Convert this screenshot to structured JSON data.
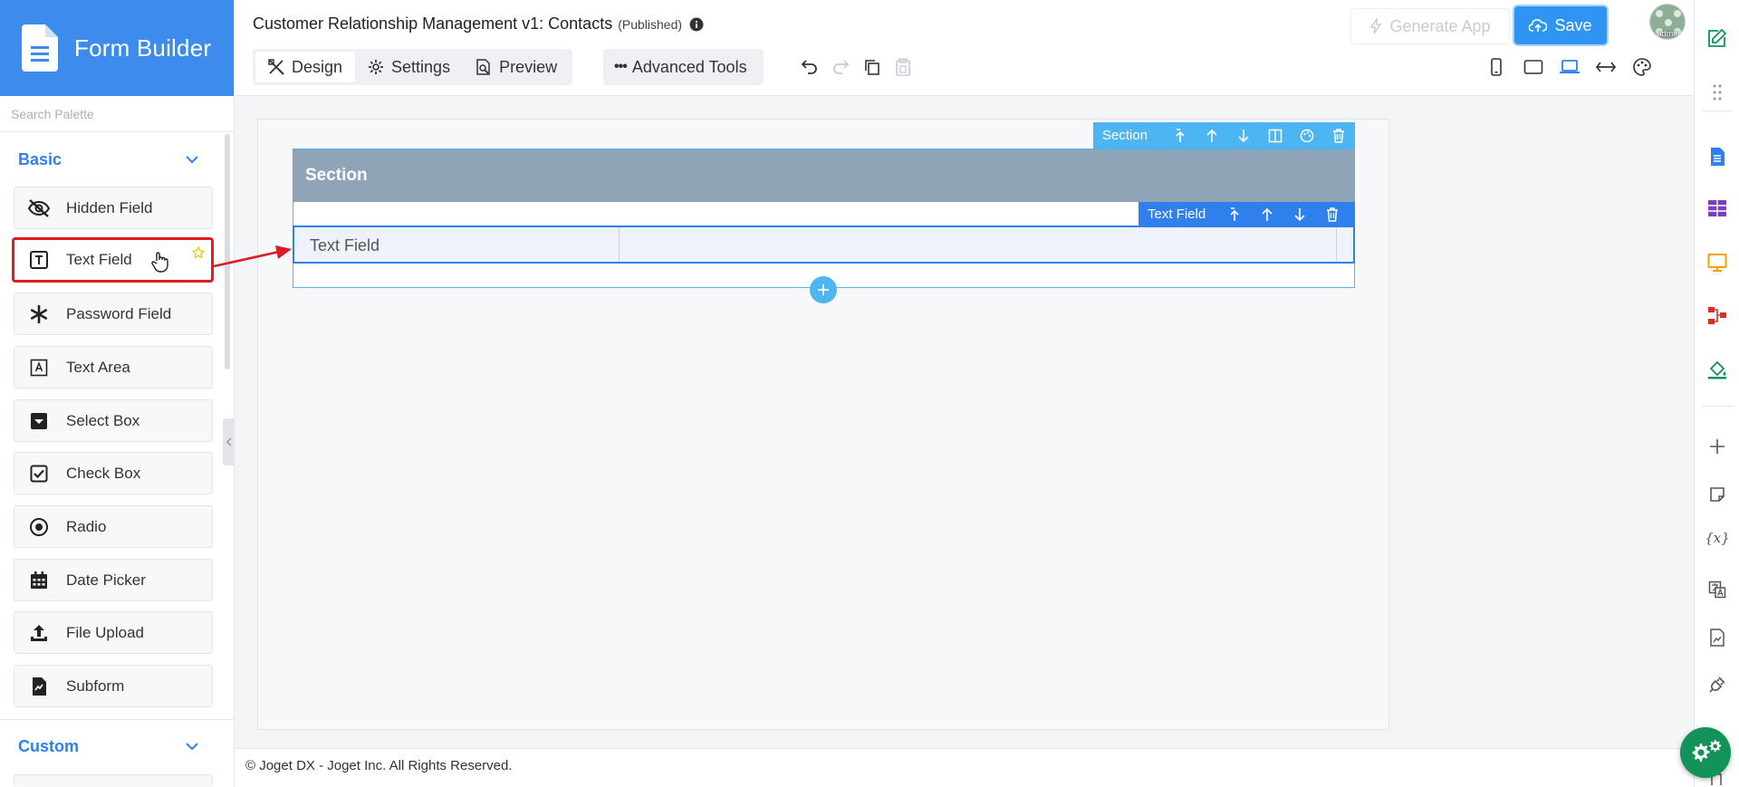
{
  "brand": {
    "title": "Form Builder"
  },
  "palette": {
    "search_placeholder": "Search Palette",
    "groups": [
      {
        "label": "Basic",
        "items": [
          {
            "label": "Hidden Field",
            "icon": "hidden-eye-icon"
          },
          {
            "label": "Text Field",
            "icon": "text-field-icon"
          },
          {
            "label": "Password Field",
            "icon": "asterisk-icon"
          },
          {
            "label": "Text Area",
            "icon": "text-area-icon"
          },
          {
            "label": "Select Box",
            "icon": "select-box-icon"
          },
          {
            "label": "Check Box",
            "icon": "checkbox-icon"
          },
          {
            "label": "Radio",
            "icon": "radio-icon"
          },
          {
            "label": "Date Picker",
            "icon": "calendar-icon"
          },
          {
            "label": "File Upload",
            "icon": "upload-icon"
          },
          {
            "label": "Subform",
            "icon": "subform-icon"
          }
        ]
      },
      {
        "label": "Custom",
        "items": []
      }
    ]
  },
  "header": {
    "app_title": "Customer Relationship Management v1: Contacts",
    "status": "(Published)",
    "tabs": [
      {
        "label": "Design",
        "icon": "design-tools-icon",
        "active": true
      },
      {
        "label": "Settings",
        "icon": "gear-icon",
        "active": false
      },
      {
        "label": "Preview",
        "icon": "preview-icon",
        "active": false
      }
    ],
    "advanced_tools": "Advanced Tools",
    "generate_app": "Generate App",
    "save": "Save",
    "avatar_label": "admin"
  },
  "canvas": {
    "section_toolbar_label": "Section",
    "section_title": "Section",
    "field_toolbar_label": "Text Field",
    "field_label": "Text Field"
  },
  "footer": {
    "copyright": "© Joget DX - Joget Inc. All Rights Reserved."
  },
  "colors": {
    "brand": "#3d8bec",
    "accent": "#2f80ed",
    "section_header": "#8fa5b7",
    "save": "#2f95f5",
    "highlight": "#e01b24",
    "fab": "#13925a"
  }
}
